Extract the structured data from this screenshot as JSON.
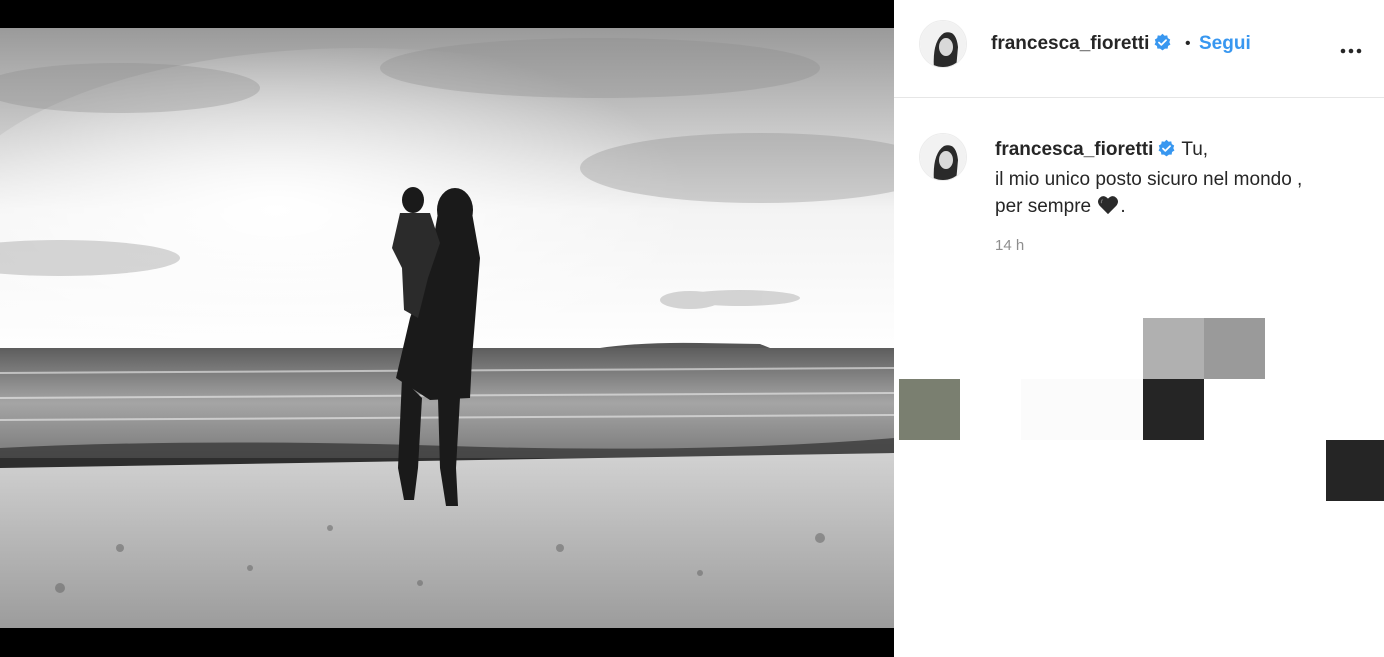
{
  "post": {
    "username": "francesca_fioretti",
    "follow_label": "Segui",
    "separator": "•",
    "more_label": "Altre opzioni"
  },
  "caption": {
    "username": "francesca_fioretti",
    "line1": "Tu,",
    "line2": "il mio unico posto sicuro nel mondo ,",
    "line3_prefix": "per sempre",
    "line3_suffix": ".",
    "timestamp": "14 h"
  },
  "colors": {
    "accent": "#3897f0",
    "text": "#262626",
    "muted": "#8e8e8e",
    "blocks": [
      "#b0b0b0",
      "#9a9a9a",
      "#7a7f70",
      "#fbfbfb",
      "#fbfbfb",
      "#252525",
      "#252525"
    ]
  },
  "icons": [
    "verified-badge-icon",
    "more-options-icon",
    "black-heart-icon"
  ]
}
